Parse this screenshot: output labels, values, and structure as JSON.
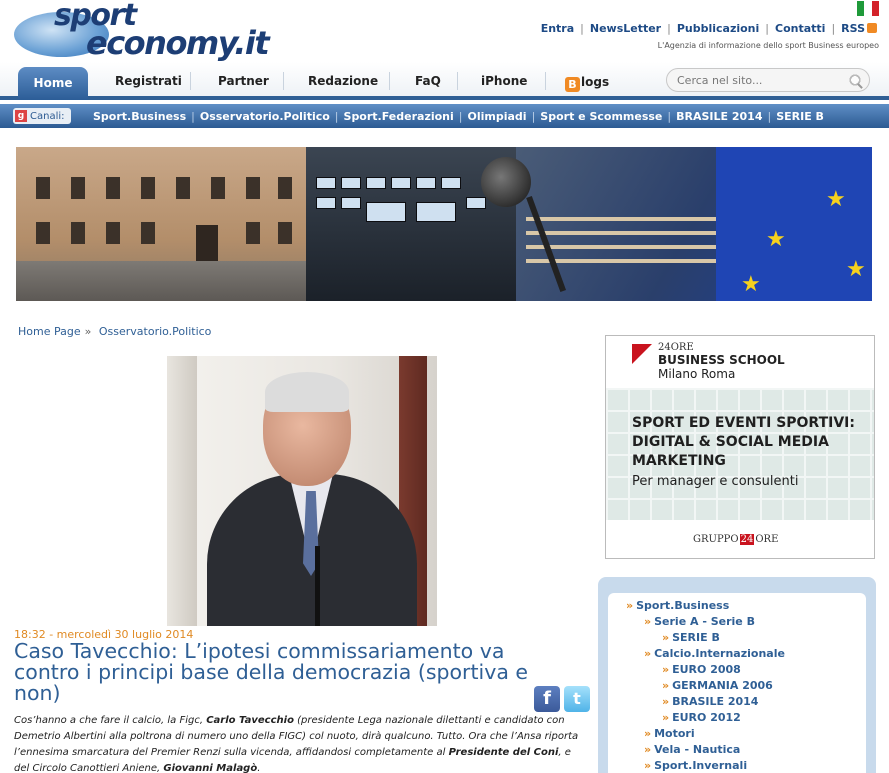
{
  "header": {
    "logo_line1": "sport",
    "logo_line2": "economy.it",
    "top_links": [
      "Entra",
      "NewsLetter",
      "Pubblicazioni",
      "Contatti",
      "RSS"
    ],
    "tagline": "L'Agenzia di informazione dello sport Business europeo"
  },
  "nav": {
    "items": [
      "Home",
      "Registrati",
      "Partner",
      "Redazione",
      "FaQ",
      "iPhone",
      "logs"
    ],
    "blog_b": "B",
    "search_placeholder": "Cerca nel sito..."
  },
  "channels": {
    "label": "Canali:",
    "g": "g",
    "links": [
      "Sport.Business",
      "Osservatorio.Politico",
      "Sport.Federazioni",
      "Olimpiadi",
      "Sport e Scommesse",
      "BRASILE 2014",
      "SERIE B"
    ]
  },
  "breadcrumb": {
    "home": "Home Page",
    "sep": "»",
    "current": "Osservatorio.Politico"
  },
  "article": {
    "date": "18:32 - mercoledì 30 luglio 2014",
    "title": "Caso Tavecchio: L’ipotesi commissariamento va contro i principi base della democrazia (sportiva e non)",
    "body_p1": "Cos’hanno a che fare il calcio, la Figc, ",
    "body_b1": "Carlo Tavecchio",
    "body_p2": " (presidente Lega nazionale dilettanti e candidato con Demetrio Albertini alla poltrona di numero uno della FIGC) col nuoto, dirà qualcuno. Tutto. Ora che l’Ansa riporta l’ennesima smarcatura del Premier Renzi sulla vicenda, affidandosi completamente al ",
    "body_b2": "Presidente del Coni",
    "body_p3": ", e del Circolo Canottieri Aniene, ",
    "body_b3": "Giovanni Malagò",
    "body_p4": "."
  },
  "share": {
    "facebook": "f",
    "twitter": "t"
  },
  "ad": {
    "brand_top": "24ORE",
    "brand_name": "BUSINESS SCHOOL",
    "brand_city": "Milano Roma",
    "headline": "SPORT ED EVENTI SPORTIVI: DIGITAL & SOCIAL MEDIA MARKETING",
    "subline": "Per manager e consulenti",
    "footer_a": "GRUPPO",
    "footer_b": "24",
    "footer_c": "ORE"
  },
  "sidemenu": {
    "items": [
      "Sport.Business",
      "Serie A - Serie B",
      "SERIE B",
      "Calcio.Internazionale",
      "EURO 2008",
      "GERMANIA 2006",
      "BRASILE 2014",
      "EURO 2012",
      "Motori",
      "Vela - Nautica",
      "Sport.Invernali"
    ]
  },
  "colors": {
    "accent": "#2f5f95",
    "date": "#e08a23",
    "nav_bar": "#2f5f95"
  }
}
